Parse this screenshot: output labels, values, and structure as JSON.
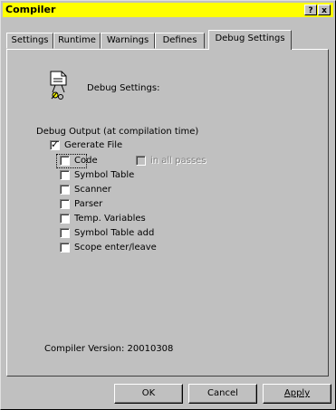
{
  "window": {
    "title": "Compiler",
    "help_button": "?",
    "close_button": "x"
  },
  "tabs": [
    {
      "label": "Settings",
      "active": false
    },
    {
      "label": "Runtime",
      "active": false
    },
    {
      "label": "Warnings",
      "active": false
    },
    {
      "label": "Defines",
      "active": false
    },
    {
      "label": "Debug Settings",
      "active": true
    }
  ],
  "header": {
    "icon": "debug-settings-icon",
    "label": "Debug Settings:"
  },
  "group": {
    "label": "Debug Output (at compilation time)",
    "options": [
      {
        "label": "Gererate File",
        "checked": true
      },
      {
        "label": "Code",
        "checked": false
      },
      {
        "label": "in all passes",
        "checked": false,
        "disabled": true
      },
      {
        "label": "Symbol Table",
        "checked": false
      },
      {
        "label": "Scanner",
        "checked": false
      },
      {
        "label": "Parser",
        "checked": false
      },
      {
        "label": "Temp. Variables",
        "checked": false
      },
      {
        "label": "Symbol Table add",
        "checked": false
      },
      {
        "label": "Scope enter/leave",
        "checked": false
      }
    ]
  },
  "version": "Compiler Version: 20010308",
  "buttons": {
    "ok": "OK",
    "cancel": "Cancel",
    "apply": "Apply"
  },
  "colors": {
    "titlebar": "#ffff00",
    "face": "#c0c0c0"
  }
}
